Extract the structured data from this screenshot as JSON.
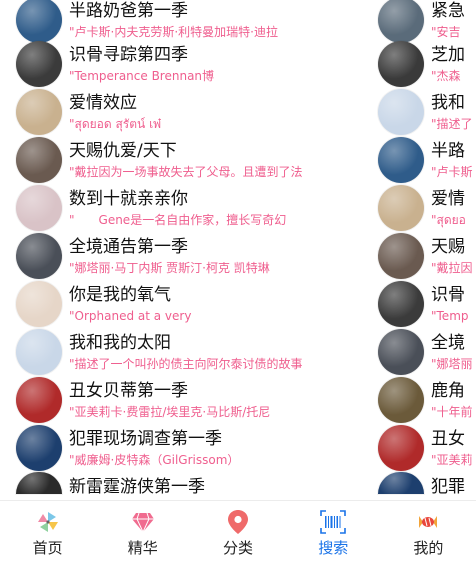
{
  "list_left": [
    {
      "title": "半路奶爸第一季",
      "subtitle": "\"卢卡斯·内夫克劳斯·利特曼加瑞特·迪拉",
      "color": "#2f5c8a"
    },
    {
      "title": "识骨寻踪第四季",
      "subtitle": "\"Temperance Brennan博",
      "color": "#3b3b3b"
    },
    {
      "title": "爱情效应",
      "subtitle": "\"สุดยอด สุรัตน์ เพ๋",
      "color": "#c9b18f"
    },
    {
      "title": "天赐仇爱/天下",
      "subtitle": "\"戴拉因为一场事故失去了父母。且遭到了法",
      "color": "#6a5a50"
    },
    {
      "title": "数到十就亲亲你",
      "subtitle": "\"　　Gene是一名自由作家，擅长写奇幻",
      "color": "#d9c3c7"
    },
    {
      "title": "全境通告第一季",
      "subtitle": "\"娜塔丽·马丁内斯 贾斯汀·柯克 凯特琳",
      "color": "#4a4f58"
    },
    {
      "title": "你是我的氧气",
      "subtitle": "\"Orphaned at a very",
      "color": "#e6d6c8"
    },
    {
      "title": "我和我的太阳",
      "subtitle": "\"描述了一个叫孙的债主向阿尔泰讨债的故事",
      "color": "#c9d7e8"
    },
    {
      "title": "丑女贝蒂第一季",
      "subtitle": "\"亚美莉卡·费雷拉/埃里克·马比斯/托尼",
      "color": "#b02a2a"
    },
    {
      "title": "犯罪现场调查第一季",
      "subtitle": "\"威廉姆·皮特森（GilGrissom）",
      "color": "#1d3f6e"
    },
    {
      "title": "新雷霆游侠第一季",
      "subtitle": "",
      "color": "#2a2a2a"
    }
  ],
  "list_right": [
    {
      "title": "紧急",
      "subtitle": "\"安吉",
      "color": "#5a6b7a"
    },
    {
      "title": "芝加",
      "subtitle": "\"杰森",
      "color": "#3a3a3a"
    },
    {
      "title": "我和",
      "subtitle": "\"描述了",
      "color": "#c9d7e8"
    },
    {
      "title": "半路",
      "subtitle": "\"卢卡斯",
      "color": "#2f5c8a"
    },
    {
      "title": "爱情",
      "subtitle": "\"สุดยอ",
      "color": "#c9b18f"
    },
    {
      "title": "天赐",
      "subtitle": "\"戴拉因",
      "color": "#6a5a50"
    },
    {
      "title": "识骨",
      "subtitle": "\"Temp",
      "color": "#3b3b3b"
    },
    {
      "title": "全境",
      "subtitle": "\"娜塔丽",
      "color": "#4a4f58"
    },
    {
      "title": "鹿角",
      "subtitle": "\"十年前",
      "color": "#6b5a3a"
    },
    {
      "title": "丑女",
      "subtitle": "\"亚美莉",
      "color": "#b02a2a"
    },
    {
      "title": "犯罪",
      "subtitle": "",
      "color": "#1d3f6e"
    }
  ],
  "tabbar": {
    "home": "首页",
    "featured": "精华",
    "category": "分类",
    "search": "搜索",
    "mine": "我的"
  },
  "accent": "#1a73e8",
  "subtitle_color": "#ef5e8e"
}
